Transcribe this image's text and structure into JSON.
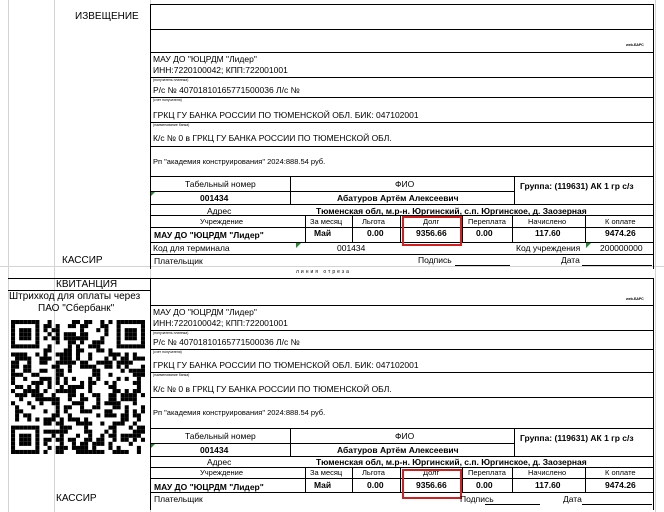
{
  "top": {
    "section_label": "ИЗВЕЩЕНИЕ",
    "cashier_label": "КАССИР",
    "cut_line": "линия отреза"
  },
  "bottom": {
    "section_label": "КВИТАНЦИЯ",
    "barcode_caption_1": "Штрихкод для оплаты через",
    "barcode_caption_2": "ПАО \"Сбербанк\"",
    "cashier_label": "КАССИР"
  },
  "logo_text": "web-БАРС",
  "recipient": {
    "name": "МАУ ДО \"ЮЦРДМ \"Лидер\"",
    "inn_kpp": "ИНН:7220100042; КПП:722001001",
    "recipient_caption": "(получатель платежа)",
    "account": "Р/с № 40701810165771500036 Л/с №",
    "account_caption": "(счет получателя)",
    "bank": "ГРКЦ ГУ БАНКА РОССИИ ПО ТЮМЕНСКОЙ ОБЛ. БИК: 047102001",
    "bank_caption": "(наименование банка)",
    "corr_account": "К/с № 0 в ГРКЦ ГУ БАНКА РОССИИ ПО ТЮМЕНСКОЙ ОБЛ.",
    "purpose": "Рп \"академия конструирования\" 2024:888.54 руб."
  },
  "payer": {
    "tab_header": "Табельный номер",
    "tab_value": "001434",
    "fio_header": "ФИО",
    "fio_value": "Абатуров Артём Алексеевич",
    "group": "Группа: (119631) АК 1 гр с/з",
    "address_label": "Адрес",
    "address_value": "Тюменская обл, м.р-н. Юргинский, с.п. Юргинское, д. Заозерная"
  },
  "charges": {
    "headers": [
      "Учреждение",
      "За месяц",
      "Льгота",
      "Долг",
      "Переплата",
      "Начислено",
      "К оплате"
    ],
    "values": [
      "МАУ ДО \"ЮЦРДМ \"Лидер\"",
      "Май",
      "0.00",
      "9356.66",
      "0.00",
      "117.60",
      "9474.26"
    ]
  },
  "terminal": {
    "label": "Код для терминала",
    "value": "001434",
    "inst_label": "Код учреждения",
    "inst_value": "200000000"
  },
  "signature": {
    "payer_label": "Плательщик",
    "sign_label": "Подпись",
    "date_label": "Дата"
  }
}
